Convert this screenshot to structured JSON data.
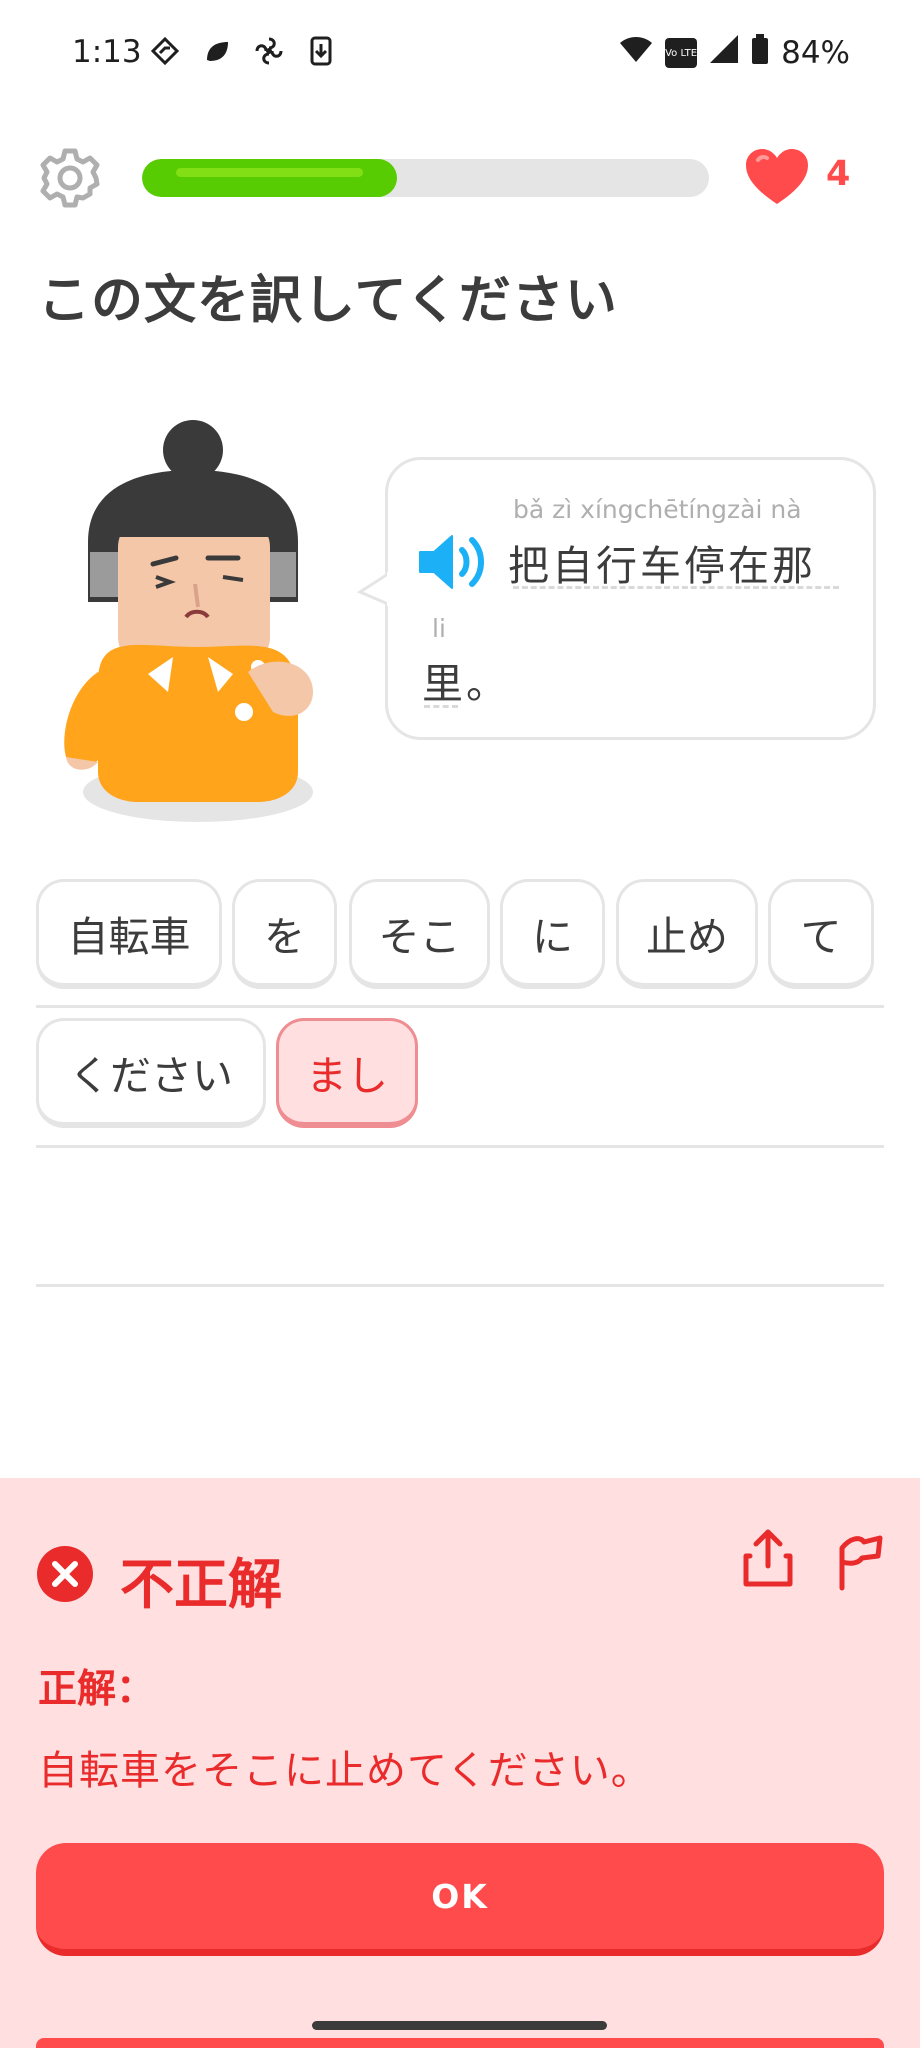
{
  "status_bar": {
    "time": "1:13",
    "battery": "84%",
    "left_icons": [
      "navigation-icon",
      "leaf-icon",
      "pinwheel-icon",
      "download-icon"
    ],
    "right_icons": [
      "wifi-icon",
      "volte-icon",
      "signal-icon",
      "battery-icon"
    ],
    "volte_label": "Vo LTE"
  },
  "header": {
    "progress": 0.45,
    "lives": "4",
    "colors": {
      "progress_fill": "#58cc02",
      "heart": "#ff4b4b"
    }
  },
  "instruction": "この文を訳してください",
  "prompt": {
    "line1": {
      "pinyin": "bǎ zì xíngchētíngzài nà",
      "hanzi": "把自行车停在那"
    },
    "line2": {
      "pinyin": "li",
      "hanzi": "里。"
    }
  },
  "word_bank": [
    {
      "label": "自転車",
      "state": "normal"
    },
    {
      "label": "を",
      "state": "normal"
    },
    {
      "label": "そこ",
      "state": "normal"
    },
    {
      "label": "に",
      "state": "normal"
    },
    {
      "label": "止め",
      "state": "normal"
    },
    {
      "label": "て",
      "state": "normal"
    },
    {
      "label": "ください",
      "state": "normal"
    },
    {
      "label": "まし",
      "state": "incorrect"
    }
  ],
  "feedback": {
    "verdict": "不正解",
    "answer_label": "正解：",
    "answer_text": "自転車をそこに止めてください。",
    "ok_label": "OK",
    "colors": {
      "panel_bg": "#ffdfe0",
      "accent": "#ea2b2b",
      "button": "#ff4b4b"
    }
  }
}
